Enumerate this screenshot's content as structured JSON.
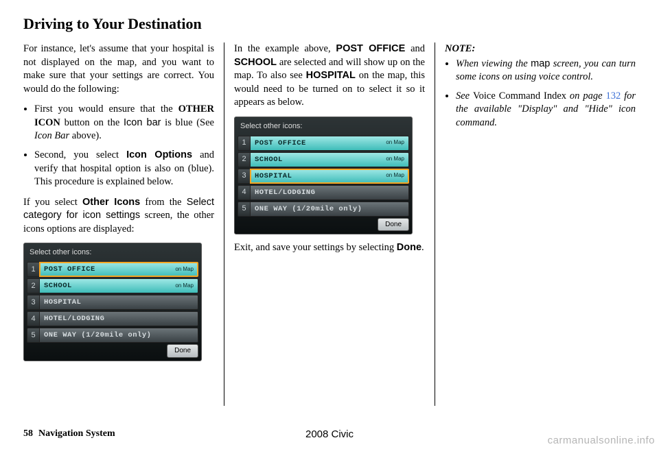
{
  "title": "Driving to Your Destination",
  "col1": {
    "p1a": "For instance, let's assume that your hospital is not displayed on the map, and you want to make sure that your settings are correct. You would do the following:",
    "li1_pre": "First you would ensure that the ",
    "li1_b": "OTHER ICON",
    "li1_mid": " button on the ",
    "li1_sans": "Icon bar",
    "li1_post": " is blue (See ",
    "li1_i": "Icon Bar",
    "li1_end": " above).",
    "li2_pre": "Second, you select ",
    "li2_b": "Icon Options",
    "li2_post": " and verify that hospital option is also on (blue). This procedure is explained below.",
    "p2_pre": "If you select ",
    "p2_b": "Other Icons",
    "p2_mid": " from the ",
    "p2_sans": "Select category for icon settings",
    "p2_post": " screen, the other icons options are displayed:"
  },
  "col2": {
    "p1_pre": "In the example above, ",
    "p1_b1": "POST OFFICE",
    "p1_mid1": " and ",
    "p1_b2": "SCHOOL",
    "p1_mid2": " are selected and will show up on the map. To also see ",
    "p1_b3": "HOSPITAL",
    "p1_post": " on the map, this would need to be turned on to select it so it appears as below.",
    "p2_pre": "Exit, and save your settings by selecting ",
    "p2_b": "Done",
    "p2_post": "."
  },
  "col3": {
    "note_label": "NOTE:",
    "li1_pre": "When viewing the ",
    "li1_sans": "map",
    "li1_post": " screen, you can turn some icons on using voice control.",
    "li2_pre": "See ",
    "li2_roman": "Voice Command Index",
    "li2_mid": " on page ",
    "li2_link": "132",
    "li2_post": " for the available \"Display\" and \"Hide\" icon command."
  },
  "shot": {
    "title": "Select other icons:",
    "rows": [
      {
        "n": "1",
        "label": "POST OFFICE",
        "tag": "on Map"
      },
      {
        "n": "2",
        "label": "SCHOOL",
        "tag": "on Map"
      },
      {
        "n": "3",
        "label": "HOSPITAL",
        "tag": "on Map"
      },
      {
        "n": "4",
        "label": "HOTEL/LODGING",
        "tag": ""
      },
      {
        "n": "5",
        "label": "ONE WAY (1/20mile only)",
        "tag": ""
      }
    ],
    "done": "Done"
  },
  "footer": {
    "pageno": "58",
    "section": "Navigation System",
    "car": "2008  Civic"
  },
  "watermark": "carmanualsonline.info"
}
